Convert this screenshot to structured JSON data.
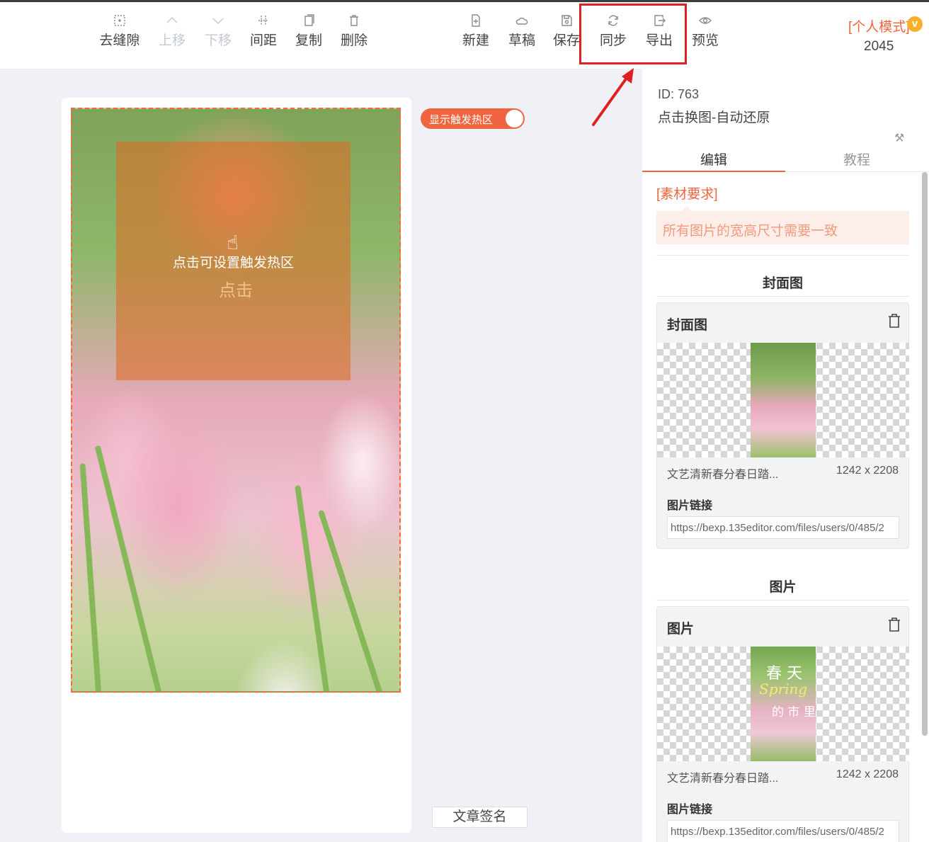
{
  "toolbar": {
    "left_tools": [
      {
        "label": "去缝隙",
        "icon": "dotted-square-icon"
      },
      {
        "label": "上移",
        "icon": "chevron-up-icon",
        "disabled": true
      },
      {
        "label": "下移",
        "icon": "chevron-down-icon",
        "disabled": true
      },
      {
        "label": "间距",
        "icon": "spacing-icon"
      },
      {
        "label": "复制",
        "icon": "copy-icon"
      },
      {
        "label": "删除",
        "icon": "trash-icon"
      }
    ],
    "right_tools": [
      {
        "label": "新建",
        "icon": "new-file-icon"
      },
      {
        "label": "草稿",
        "icon": "cloud-icon"
      },
      {
        "label": "保存",
        "icon": "save-icon"
      },
      {
        "label": "同步",
        "icon": "sync-icon"
      },
      {
        "label": "导出",
        "icon": "export-icon"
      },
      {
        "label": "预览",
        "icon": "eye-icon"
      }
    ],
    "mode": "[个人模式]",
    "badge": "v",
    "count": "2045",
    "highlight_color": "#e02020"
  },
  "canvas": {
    "toggle_label": "显示触发热区",
    "hotzone_text": "点击可设置触发热区",
    "hotzone_click": "点击",
    "signature": "文章签名"
  },
  "panel": {
    "id": "ID: 763",
    "name": "点击换图-自动还原",
    "tabs": [
      "编辑",
      "教程"
    ],
    "requirements_title": "[素材要求]",
    "requirements_text": "所有图片的宽高尺寸需要一致",
    "sections": [
      {
        "heading": "封面图",
        "card_title": "封面图",
        "file_name": "文艺清新春分春日踏...",
        "size": "1242 x 2208",
        "link_label": "图片链接",
        "link": "https://bexp.135editor.com/files/users/0/485/2"
      },
      {
        "heading": "图片",
        "card_title": "图片",
        "file_name": "文艺清新春分春日踏...",
        "size": "1242 x 2208",
        "link_label": "图片链接",
        "link": "https://bexp.135editor.com/files/users/0/485/2",
        "thumb_text": [
          "春 天",
          "Spring",
          "的 市 里"
        ]
      }
    ]
  },
  "colors": {
    "accent": "#f0653f",
    "hotzone": "#dc6e28"
  }
}
